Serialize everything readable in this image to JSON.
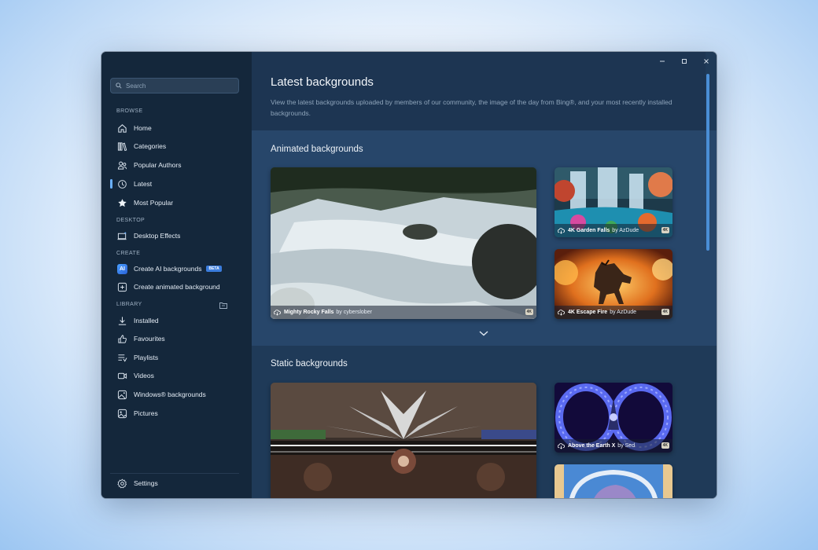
{
  "search": {
    "placeholder": "Search"
  },
  "sidebar": {
    "browse_label": "BROWSE",
    "desktop_label": "DESKTOP",
    "create_label": "CREATE",
    "library_label": "LIBRARY",
    "items": {
      "home": "Home",
      "categories": "Categories",
      "popular_authors": "Popular Authors",
      "latest": "Latest",
      "most_popular": "Most Popular",
      "desktop_effects": "Desktop Effects",
      "create_ai": "Create AI backgrounds",
      "beta": "BETA",
      "create_animated": "Create animated background",
      "installed": "Installed",
      "favourites": "Favourites",
      "playlists": "Playlists",
      "videos": "Videos",
      "windows_backgrounds": "Windows® backgrounds",
      "pictures": "Pictures",
      "settings": "Settings"
    },
    "ai_badge": "AI",
    "active_color": "#6ab0ff"
  },
  "header": {
    "title": "Latest backgrounds",
    "description": "View the latest backgrounds uploaded by members of our community, the image of the day from Bing®, and your most recently installed backgrounds."
  },
  "animated": {
    "title": "Animated backgrounds",
    "cards": [
      {
        "name": "Mighty Rocky Falls",
        "by": "by cyberslober",
        "badge": "4K"
      },
      {
        "name": "4K Garden Falls",
        "by": "by AzDude",
        "badge": "4K"
      },
      {
        "name": "4K Escape Fire",
        "by": "by AzDude",
        "badge": "4K"
      }
    ]
  },
  "static": {
    "title": "Static backgrounds",
    "cards": [
      {
        "name": "Above the Earth X",
        "by": "by Sed",
        "badge": "4K"
      }
    ]
  }
}
